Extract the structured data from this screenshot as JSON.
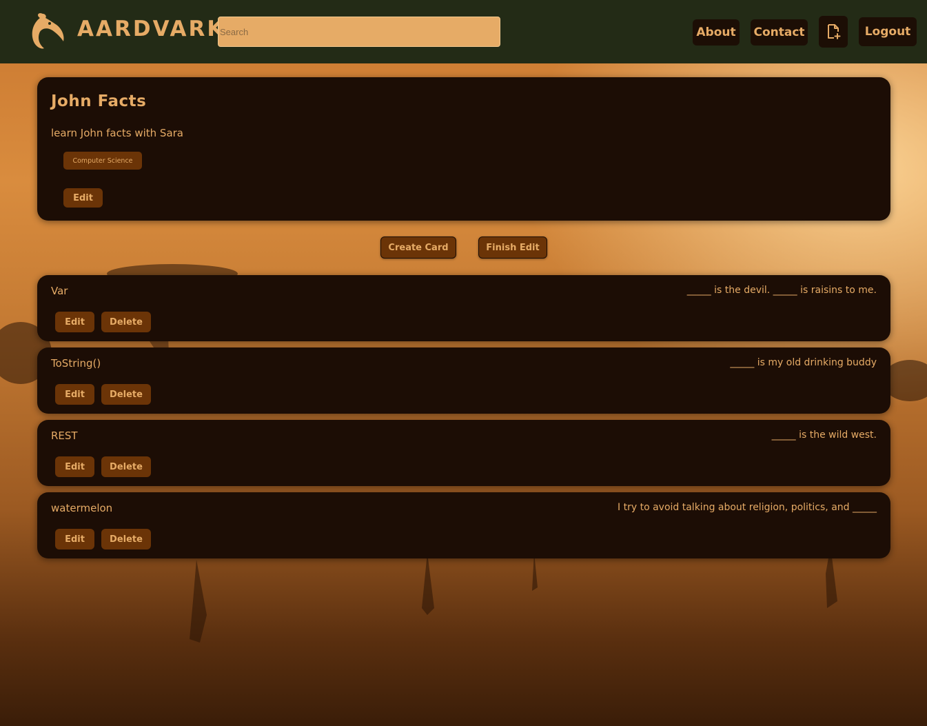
{
  "header": {
    "brand": "AARDVARK",
    "search_placeholder": "Search",
    "nav": {
      "about": "About",
      "contact": "Contact",
      "logout": "Logout"
    }
  },
  "deck": {
    "title": "John Facts",
    "description": "learn John facts with Sara",
    "tag": "Computer Science",
    "edit_label": "Edit"
  },
  "actions": {
    "create_card": "Create Card",
    "finish_edit": "Finish Edit"
  },
  "cards": [
    {
      "term": "Var",
      "definition": "_____ is the devil. _____ is raisins to me.",
      "edit": "Edit",
      "delete": "Delete"
    },
    {
      "term": "ToString()",
      "definition": "_____ is my old drinking buddy",
      "edit": "Edit",
      "delete": "Delete"
    },
    {
      "term": "REST",
      "definition": "_____ is the wild west.",
      "edit": "Edit",
      "delete": "Delete"
    },
    {
      "term": "watermelon",
      "definition": "I try to avoid talking about religion, politics, and _____",
      "edit": "Edit",
      "delete": "Delete"
    }
  ],
  "colors": {
    "accent": "#e6ab66",
    "panel": "#1c0d05",
    "button": "#6b3407",
    "header": "#232b16"
  },
  "icons": {
    "logo": "aardvark-logo-icon",
    "new_deck": "new-file-icon"
  }
}
